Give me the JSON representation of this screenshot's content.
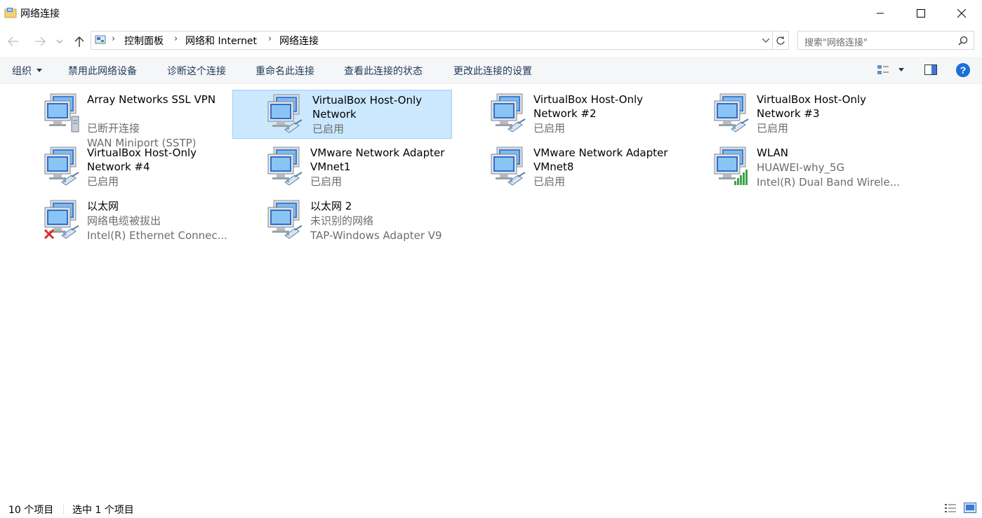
{
  "window": {
    "title": "网络连接",
    "minimize_icon": "minimize-icon",
    "maximize_icon": "maximize-icon",
    "close_icon": "close-icon"
  },
  "address": {
    "crumbs": [
      "控制面板",
      "网络和 Internet",
      "网络连接"
    ],
    "search_placeholder": "搜索\"网络连接\""
  },
  "toolbar": {
    "organize": "组织",
    "items": [
      "禁用此网络设备",
      "诊断这个连接",
      "重命名此连接",
      "查看此连接的状态",
      "更改此连接的设置"
    ]
  },
  "connections": [
    {
      "name": "Array Networks SSL VPN",
      "status": "已断开连接",
      "device": "WAN Miniport (SSTP)",
      "icon": "vpn-network-icon"
    },
    {
      "name": "VirtualBox Host-Only Network",
      "status": "已启用",
      "device": "",
      "icon": "network-cable-icon",
      "selected": true
    },
    {
      "name": "VirtualBox Host-Only Network #2",
      "status": "已启用",
      "device": "",
      "icon": "network-cable-icon"
    },
    {
      "name": "VirtualBox Host-Only Network #3",
      "status": "已启用",
      "device": "",
      "icon": "network-cable-icon"
    },
    {
      "name": "VirtualBox Host-Only Network #4",
      "status": "已启用",
      "device": "",
      "icon": "network-cable-icon"
    },
    {
      "name": "VMware Network Adapter VMnet1",
      "status": "已启用",
      "device": "",
      "icon": "network-cable-icon"
    },
    {
      "name": "VMware Network Adapter VMnet8",
      "status": "已启用",
      "device": "",
      "icon": "network-cable-icon"
    },
    {
      "name": "WLAN",
      "status": "HUAWEI-why_5G",
      "device": "Intel(R) Dual Band Wirele...",
      "icon": "wifi-signal-icon"
    },
    {
      "name": "以太网",
      "status": "网络电缆被拔出",
      "device": "Intel(R) Ethernet Connec...",
      "icon": "network-disconnected-icon"
    },
    {
      "name": "以太网 2",
      "status": "未识别的网络",
      "device": "TAP-Windows Adapter V9",
      "icon": "network-cable-icon"
    }
  ],
  "statusbar": {
    "count": "10 个项目",
    "selected": "选中 1 个项目"
  }
}
